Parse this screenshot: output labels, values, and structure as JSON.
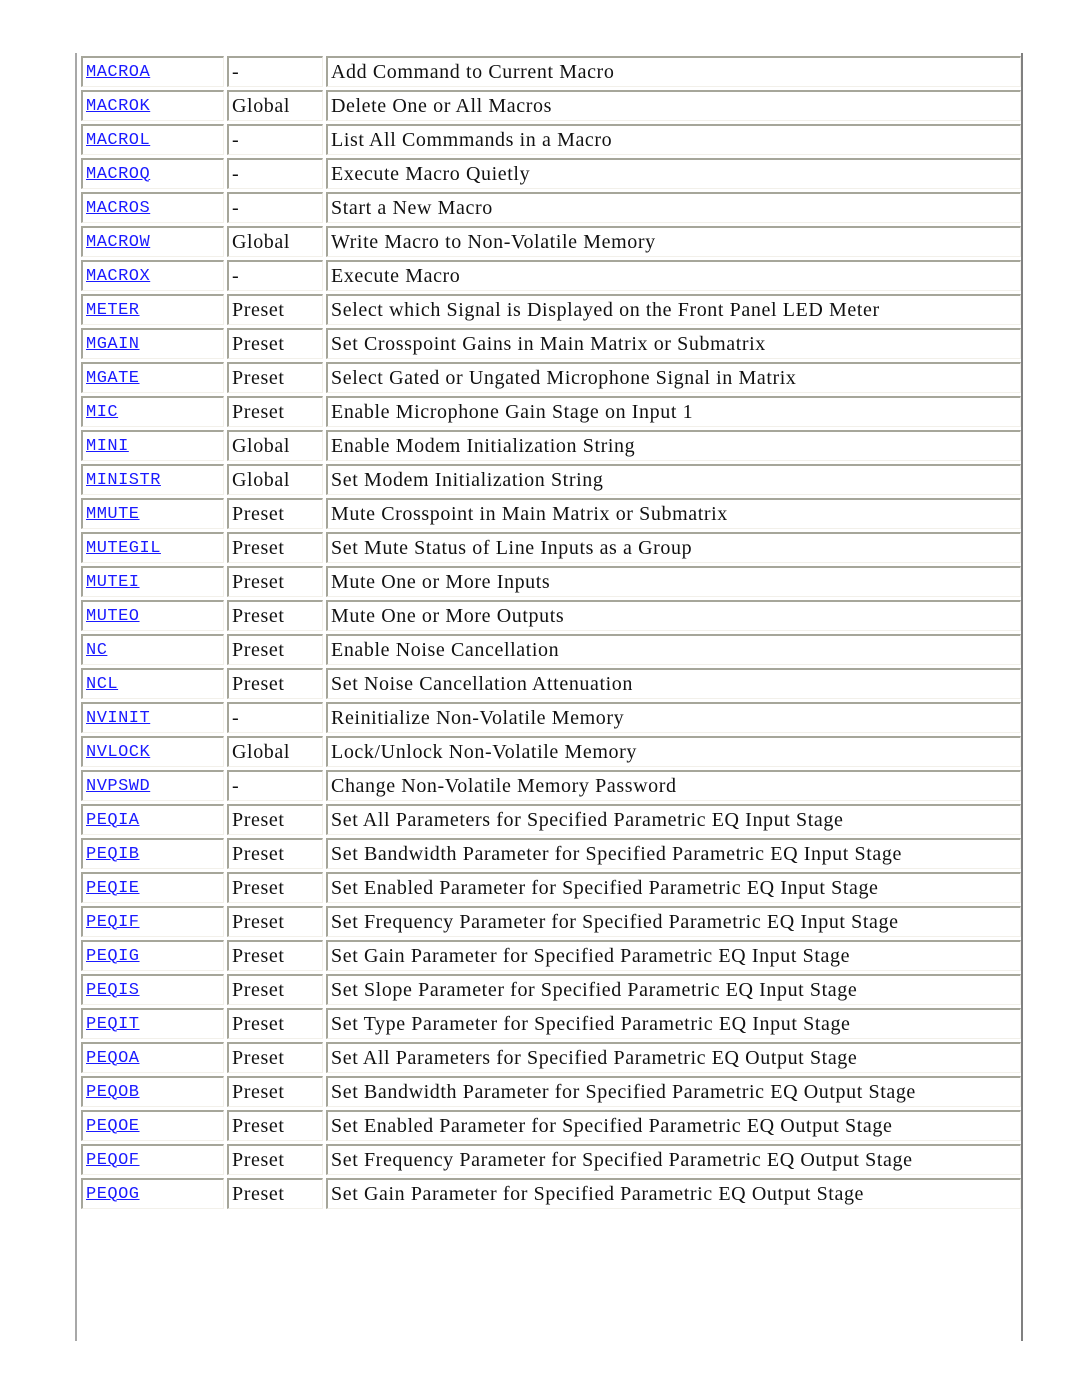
{
  "table": {
    "rows": [
      {
        "command": "MACROA",
        "scope": "-",
        "description": "Add Command to Current Macro"
      },
      {
        "command": "MACROK",
        "scope": "Global",
        "description": "Delete One or All Macros"
      },
      {
        "command": "MACROL",
        "scope": "-",
        "description": "List All Commmands in a Macro"
      },
      {
        "command": "MACROQ",
        "scope": "-",
        "description": "Execute Macro Quietly"
      },
      {
        "command": "MACROS",
        "scope": "-",
        "description": "Start a New Macro"
      },
      {
        "command": "MACROW",
        "scope": "Global",
        "description": "Write Macro to Non-Volatile Memory"
      },
      {
        "command": "MACROX",
        "scope": "-",
        "description": "Execute Macro"
      },
      {
        "command": "METER",
        "scope": "Preset",
        "description": "Select which Signal is Displayed on the Front Panel LED Meter"
      },
      {
        "command": "MGAIN",
        "scope": "Preset",
        "description": "Set Crosspoint Gains in Main Matrix or Submatrix"
      },
      {
        "command": "MGATE",
        "scope": "Preset",
        "description": "Select Gated or Ungated Microphone Signal in Matrix"
      },
      {
        "command": "MIC",
        "scope": "Preset",
        "description": "Enable Microphone Gain Stage on Input 1"
      },
      {
        "command": "MINI",
        "scope": "Global",
        "description": "Enable Modem Initialization String"
      },
      {
        "command": "MINISTR",
        "scope": "Global",
        "description": "Set Modem Initialization String"
      },
      {
        "command": "MMUTE",
        "scope": "Preset",
        "description": "Mute Crosspoint in Main Matrix or Submatrix"
      },
      {
        "command": "MUTEGIL",
        "scope": "Preset",
        "description": "Set Mute Status of Line Inputs as a Group"
      },
      {
        "command": "MUTEI",
        "scope": "Preset",
        "description": "Mute One or More Inputs"
      },
      {
        "command": "MUTEO",
        "scope": "Preset",
        "description": "Mute One or More Outputs"
      },
      {
        "command": "NC",
        "scope": "Preset",
        "description": "Enable Noise Cancellation"
      },
      {
        "command": "NCL",
        "scope": "Preset",
        "description": "Set Noise Cancellation Attenuation"
      },
      {
        "command": "NVINIT",
        "scope": "-",
        "description": "Reinitialize Non-Volatile Memory"
      },
      {
        "command": "NVLOCK",
        "scope": "Global",
        "description": "Lock/Unlock Non-Volatile Memory"
      },
      {
        "command": "NVPSWD",
        "scope": "-",
        "description": "Change Non-Volatile Memory Password"
      },
      {
        "command": "PEQIA",
        "scope": "Preset",
        "description": "Set All Parameters for Specified Parametric EQ Input Stage"
      },
      {
        "command": "PEQIB",
        "scope": "Preset",
        "description": "Set Bandwidth Parameter for Specified Parametric EQ Input Stage"
      },
      {
        "command": "PEQIE",
        "scope": "Preset",
        "description": "Set Enabled Parameter for Specified Parametric EQ Input Stage"
      },
      {
        "command": "PEQIF",
        "scope": "Preset",
        "description": "Set Frequency Parameter for Specified Parametric EQ Input Stage"
      },
      {
        "command": "PEQIG",
        "scope": "Preset",
        "description": "Set Gain Parameter for Specified Parametric EQ Input Stage"
      },
      {
        "command": "PEQIS",
        "scope": "Preset",
        "description": "Set Slope Parameter for Specified Parametric EQ Input Stage"
      },
      {
        "command": "PEQIT",
        "scope": "Preset",
        "description": "Set Type Parameter for Specified Parametric EQ Input Stage"
      },
      {
        "command": "PEQOA",
        "scope": "Preset",
        "description": "Set All Parameters for Specified Parametric EQ Output Stage"
      },
      {
        "command": "PEQOB",
        "scope": "Preset",
        "description": "Set Bandwidth Parameter for Specified Parametric EQ Output Stage"
      },
      {
        "command": "PEQOE",
        "scope": "Preset",
        "description": "Set Enabled Parameter for Specified Parametric EQ Output Stage"
      },
      {
        "command": "PEQOF",
        "scope": "Preset",
        "description": "Set Frequency Parameter for Specified Parametric EQ Output Stage"
      },
      {
        "command": "PEQOG",
        "scope": "Preset",
        "description": "Set Gain Parameter for Specified Parametric EQ Output Stage"
      }
    ]
  }
}
